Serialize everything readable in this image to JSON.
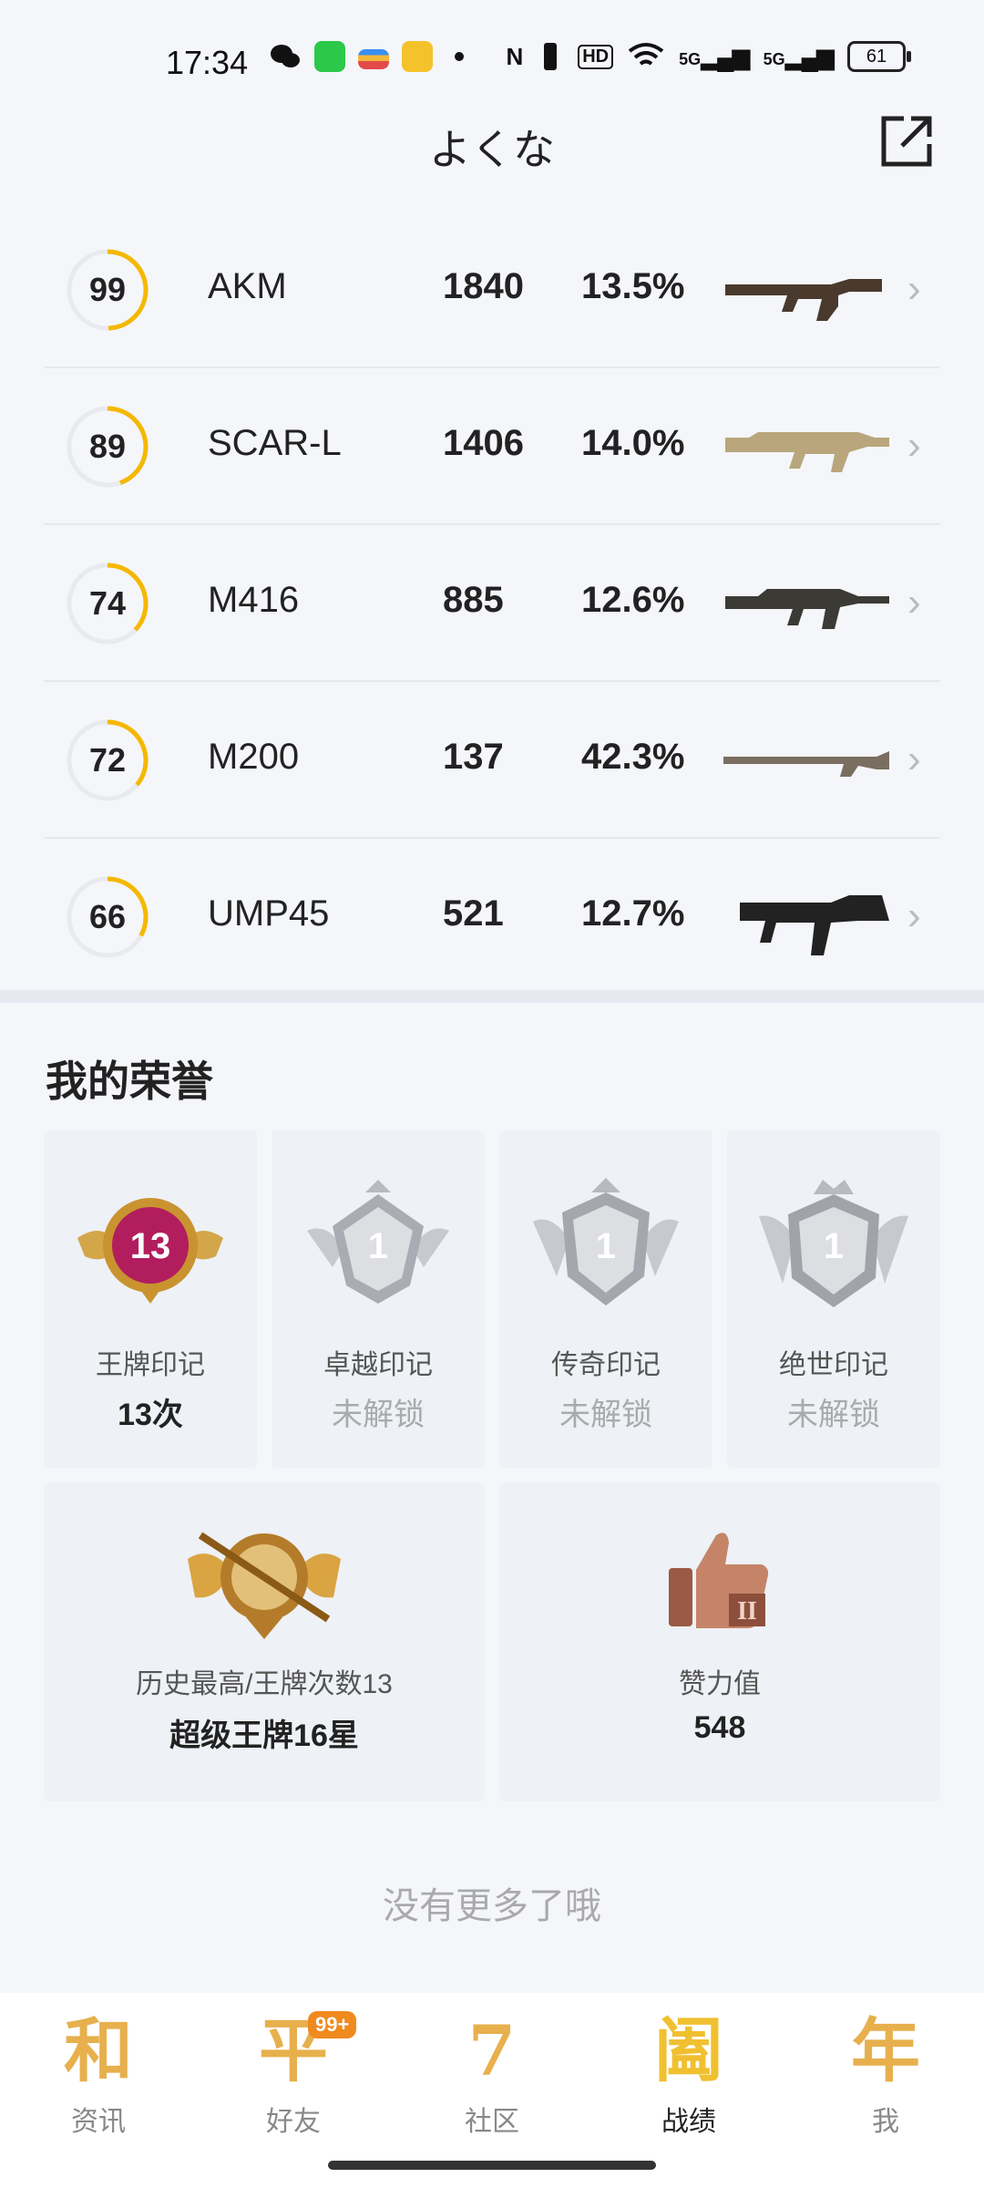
{
  "status_bar": {
    "time": "17:34",
    "battery": "61",
    "signal_1": "5G",
    "signal_2": "5G",
    "hd": "HD"
  },
  "header": {
    "title": "よくな"
  },
  "weapons": [
    {
      "score": "99",
      "score_value": 99,
      "name": "AKM",
      "kills": "1840",
      "rate": "13.5%"
    },
    {
      "score": "89",
      "score_value": 89,
      "name": "SCAR-L",
      "kills": "1406",
      "rate": "14.0%"
    },
    {
      "score": "74",
      "score_value": 74,
      "name": "M416",
      "kills": "885",
      "rate": "12.6%"
    },
    {
      "score": "72",
      "score_value": 72,
      "name": "M200",
      "kills": "137",
      "rate": "42.3%"
    },
    {
      "score": "66",
      "score_value": 66,
      "name": "UMP45",
      "kills": "521",
      "rate": "12.7%"
    }
  ],
  "honor": {
    "title": "我的荣誉",
    "marks": [
      {
        "badge_num": "13",
        "label": "王牌印记",
        "value": "13次",
        "locked": false
      },
      {
        "badge_num": "1",
        "label": "卓越印记",
        "value": "未解锁",
        "locked": true
      },
      {
        "badge_num": "1",
        "label": "传奇印记",
        "value": "未解锁",
        "locked": true
      },
      {
        "badge_num": "1",
        "label": "绝世印记",
        "value": "未解锁",
        "locked": true
      }
    ],
    "highest": {
      "label": "历史最高/王牌次数13",
      "value": "超级王牌16星"
    },
    "likes": {
      "label": "赞力值",
      "value": "548"
    }
  },
  "no_more": "没有更多了哦",
  "nav": [
    {
      "icon_char": "和",
      "label": "资讯"
    },
    {
      "icon_char": "平",
      "label": "好友",
      "badge": "99+"
    },
    {
      "icon_char": "7",
      "label": "社区"
    },
    {
      "icon_char": "阖",
      "label": "战绩"
    },
    {
      "icon_char": "年",
      "label": "我"
    }
  ],
  "colors": {
    "accent": "#f5b800",
    "ring_track": "#e8eaee"
  }
}
